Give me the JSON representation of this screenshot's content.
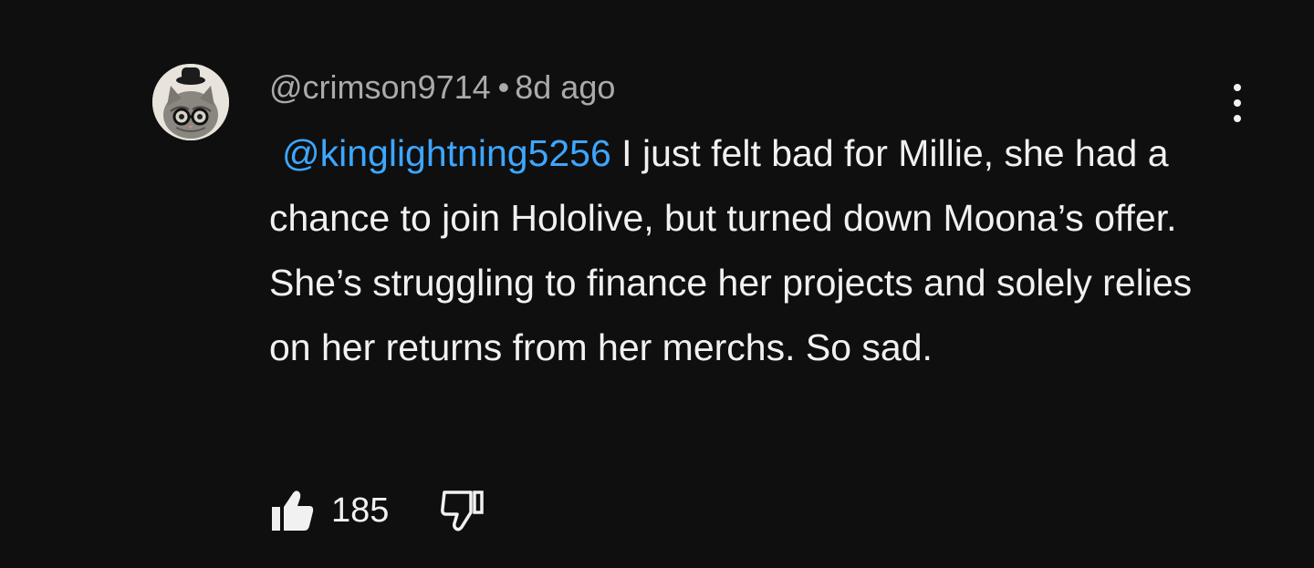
{
  "comment": {
    "author": "@crimson9714",
    "separator": "•",
    "timestamp": "8d ago",
    "mention": "@kinglightning5256",
    "text": " I just felt bad for Millie, she had a chance to join Hololive, but turned down Moona’s offer. She’s struggling to finance her projects and solely relies on her returns from her merchs. So sad.",
    "like_count": "185",
    "icons": {
      "avatar": "cat-with-glasses-avatar",
      "menu": "more-vert-icon",
      "like": "thumbs-up-icon",
      "dislike": "thumbs-down-icon"
    },
    "colors": {
      "background": "#0f0f0f",
      "text": "#f1f1f1",
      "meta": "#aaaaaa",
      "mention": "#3ea6ff"
    }
  }
}
